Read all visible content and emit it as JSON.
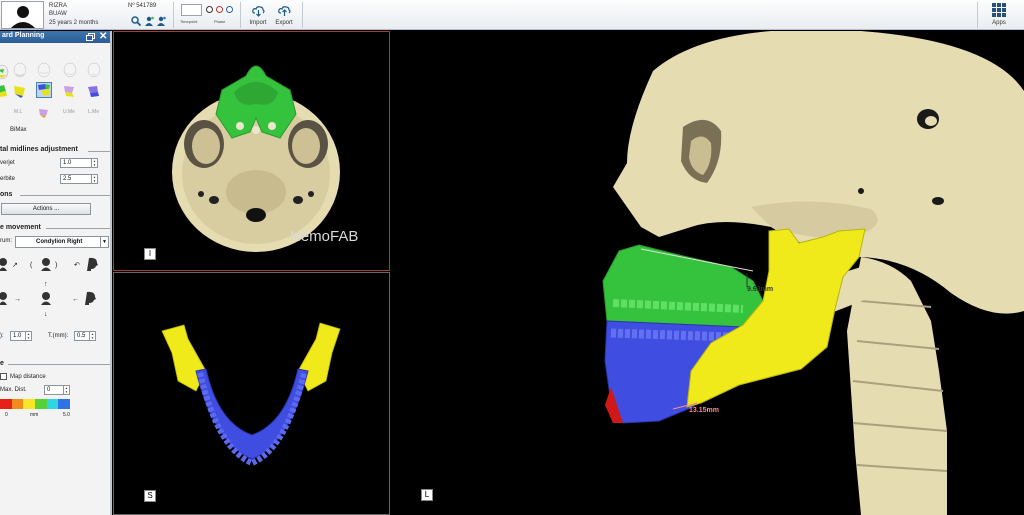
{
  "patient": {
    "name": "RIZRA",
    "surname": "BUAW",
    "age": "25 years 2 months",
    "number": "Nº 541789"
  },
  "toolbar": {
    "timepoint_label": "Timepoint",
    "phase_label": "Phase",
    "import_label": "Import",
    "export_label": "Export",
    "apps_label": "Apps"
  },
  "panel": {
    "title": "ard Planning",
    "seg_labels": [
      "M.L",
      "U.Me",
      "L.Me"
    ],
    "bimax_label": "BiMax",
    "midlines_title": "tal midlines adjustment",
    "overjet_label": "verjet",
    "overjet_value": "1.0",
    "overbite_label": "erbite",
    "overbite_value": "2.5",
    "actions_title": "ons",
    "actions_button": "Actions ...",
    "movement_title": "e movement",
    "pivot_label": "rum:",
    "pivot_value": "Condylion Right",
    "r_label": "):",
    "r_value": "1.0",
    "t_label": "T.(mm):",
    "t_value": "0.5",
    "map_title": "e",
    "map_distance_label": "Map distance",
    "max_dist_label": "Max. Dist.",
    "max_dist_value": "0",
    "scale_min": "0",
    "scale_unit": "mm",
    "scale_max": "5.0",
    "scale_colors": [
      "#e8201a",
      "#f28a1c",
      "#f5e628",
      "#57d13a",
      "#2fd6e0",
      "#2f72e6"
    ]
  },
  "viewports": {
    "inferior_label": "I",
    "superior_label": "S",
    "lateral_label": "L",
    "brand": "NemoFAB",
    "measure_1": "9.63mm",
    "measure_2": "13.15mm"
  },
  "colors": {
    "bone": "#e6dcb2",
    "maxilla": "#35c23c",
    "mandible_teeth": "#3f4ee0",
    "ramus": "#f0ea1a",
    "chin": "#d11818",
    "accent": "#2b5e98"
  }
}
